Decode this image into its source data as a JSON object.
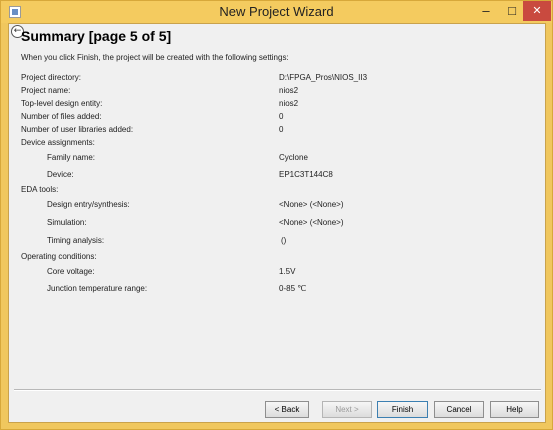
{
  "window": {
    "title": "New Project Wizard"
  },
  "titlebar": {
    "min": "–",
    "max": "□",
    "close": "✕"
  },
  "page": {
    "heading": "Summary [page 5 of 5]",
    "intro": "When you click Finish, the project will be created with the following settings:"
  },
  "settings": {
    "project_directory": {
      "label": "Project directory:",
      "value": "D:\\FPGA_Pros\\NIOS_II3"
    },
    "project_name": {
      "label": "Project name:",
      "value": "nios2"
    },
    "top_level": {
      "label": "Top-level design entity:",
      "value": "nios2"
    },
    "files_added": {
      "label": "Number of files added:",
      "value": "0"
    },
    "user_libraries": {
      "label": "Number of user libraries added:",
      "value": "0"
    },
    "device_assignments": {
      "label": "Device assignments:"
    },
    "family_name": {
      "label": "Family name:",
      "value": "Cyclone"
    },
    "device": {
      "label": "Device:",
      "value": "EP1C3T144C8"
    },
    "eda_tools": {
      "label": "EDA tools:"
    },
    "design_entry": {
      "label": "Design entry/synthesis:",
      "value": "<None> (<None>)"
    },
    "simulation": {
      "label": "Simulation:",
      "value": "<None> (<None>)"
    },
    "timing_analysis": {
      "label": "Timing analysis:",
      "value": "()"
    },
    "operating_conditions": {
      "label": "Operating conditions:"
    },
    "core_voltage": {
      "label": "Core voltage:",
      "value": "1.5V"
    },
    "junction_temp": {
      "label": "Junction temperature range:",
      "value": "0-85 ℃"
    }
  },
  "buttons": {
    "back": "< Back",
    "next": "Next >",
    "finish": "Finish",
    "cancel": "Cancel",
    "help": "Help"
  }
}
